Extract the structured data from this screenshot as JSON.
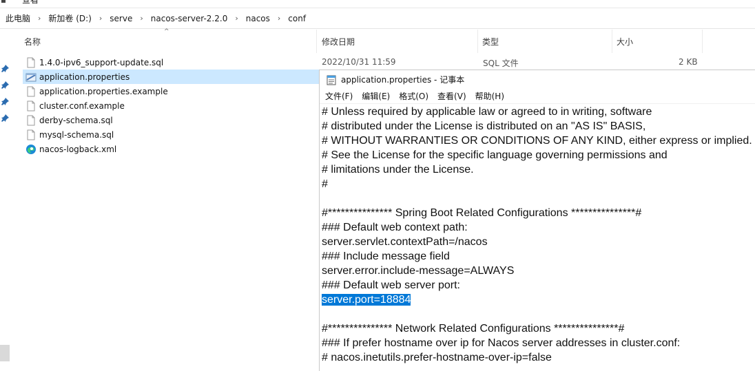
{
  "ribbon": {
    "visible_tab": "查看"
  },
  "breadcrumb": [
    "此电脑",
    "新加卷 (D:)",
    "serve",
    "nacos-server-2.2.0",
    "nacos",
    "conf"
  ],
  "columns": {
    "name": "名称",
    "modified": "修改日期",
    "type": "类型",
    "size": "大小"
  },
  "files": [
    {
      "name": "1.4.0-ipv6_support-update.sql",
      "icon": "file-icon",
      "modified": "2022/10/31 11:59",
      "type": "SQL 文件",
      "size": "2 KB",
      "selected": false
    },
    {
      "name": "application.properties",
      "icon": "properties-file-icon",
      "selected": true
    },
    {
      "name": "application.properties.example",
      "icon": "file-icon",
      "selected": false
    },
    {
      "name": "cluster.conf.example",
      "icon": "file-icon",
      "selected": false
    },
    {
      "name": "derby-schema.sql",
      "icon": "file-icon",
      "selected": false
    },
    {
      "name": "mysql-schema.sql",
      "icon": "file-icon",
      "selected": false
    },
    {
      "name": "nacos-logback.xml",
      "icon": "edge-icon",
      "selected": false
    }
  ],
  "notepad": {
    "title": "application.properties - 记事本",
    "menu": [
      "文件(F)",
      "编辑(E)",
      "格式(O)",
      "查看(V)",
      "帮助(H)"
    ],
    "lines": [
      "# Unless required by applicable law or agreed to in writing, software",
      "# distributed under the License is distributed on an \"AS IS\" BASIS,",
      "# WITHOUT WARRANTIES OR CONDITIONS OF ANY KIND, either express or implied.",
      "# See the License for the specific language governing permissions and",
      "# limitations under the License.",
      "#",
      "",
      "#*************** Spring Boot Related Configurations ***************#",
      "### Default web context path:",
      "server.servlet.contextPath=/nacos",
      "### Include message field",
      "server.error.include-message=ALWAYS",
      "### Default web server port:",
      "server.port=18884",
      "",
      "#*************** Network Related Configurations ***************#",
      "### If prefer hostname over ip for Nacos server addresses in cluster.conf:",
      "# nacos.inetutils.prefer-hostname-over-ip=false"
    ],
    "selected_line": 13,
    "selection_color": "#0078d7"
  },
  "colors": {
    "row_selected": "#cce8ff"
  }
}
